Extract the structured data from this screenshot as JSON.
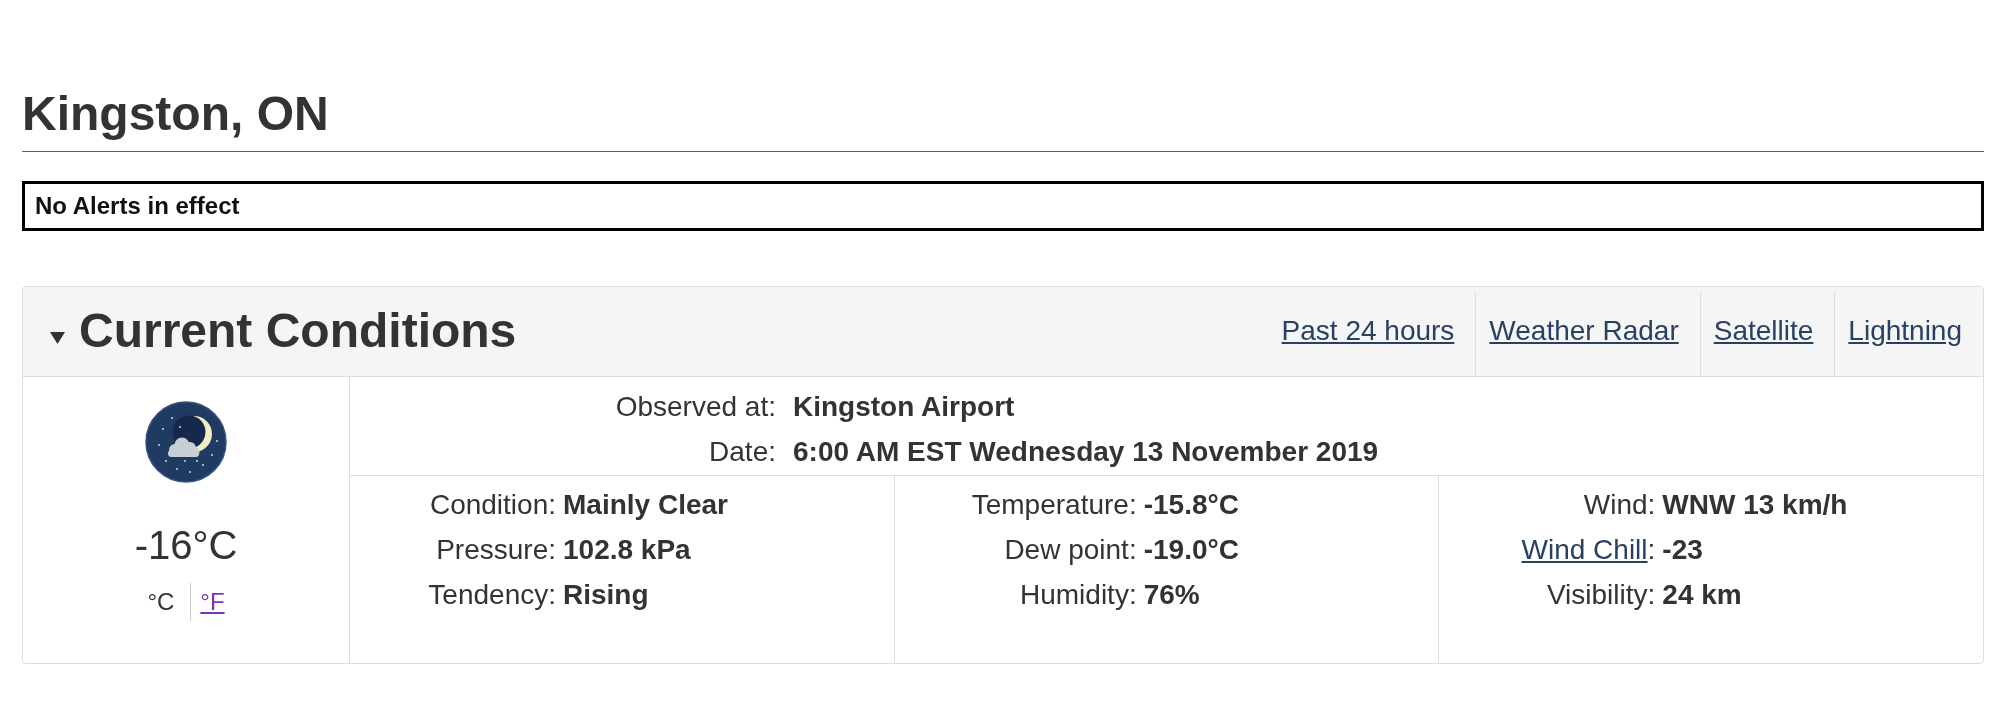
{
  "location": {
    "title": "Kingston, ON"
  },
  "alerts": {
    "text": "No Alerts in effect"
  },
  "current_conditions": {
    "title": "Current Conditions",
    "expanded": true,
    "links": [
      "Past 24 hours",
      "Weather Radar",
      "Satellite",
      "Lightning"
    ],
    "summary": {
      "temperature": "-16°C",
      "units": [
        {
          "label": "°C",
          "selected": true
        },
        {
          "label": "°F",
          "selected": false
        }
      ]
    },
    "station": [
      {
        "label": "Observed at:",
        "value": "Kingston Airport"
      },
      {
        "label": "Date:",
        "value": "6:00 AM EST Wednesday 13 November 2019"
      }
    ],
    "columns": [
      {
        "items": [
          {
            "kind": "text",
            "label": "Condition:",
            "value": "Mainly Clear"
          },
          {
            "kind": "text",
            "label": "Pressure:",
            "value": "102.8 kPa"
          },
          {
            "kind": "text",
            "label": "Tendency:",
            "value": "Rising"
          }
        ]
      },
      {
        "items": [
          {
            "kind": "text",
            "label": "Temperature:",
            "value": "-15.8°C"
          },
          {
            "kind": "text",
            "label": "Dew point:",
            "value": "-19.0°C"
          },
          {
            "kind": "text",
            "label": "Humidity:",
            "value": "76%"
          }
        ]
      },
      {
        "items": [
          {
            "kind": "text",
            "label": "Wind:",
            "value": "WNW 13 km/h"
          },
          {
            "kind": "link",
            "label": "Wind Chill",
            "label_suffix": ":",
            "value": "-23"
          },
          {
            "kind": "text",
            "label": "Visibility:",
            "value": "24 km"
          }
        ]
      }
    ]
  }
}
